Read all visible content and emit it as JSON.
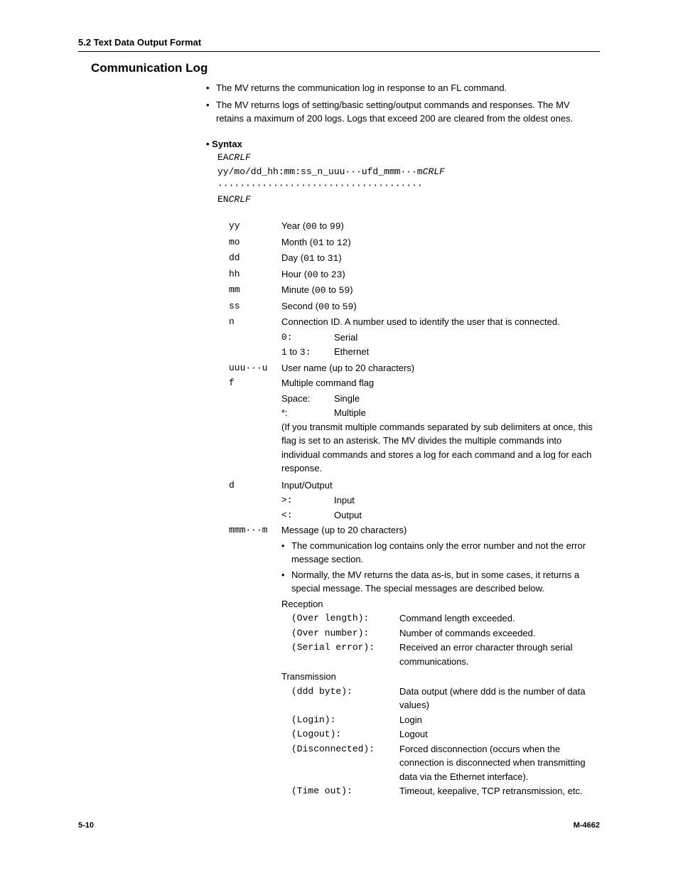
{
  "header": "5.2  Text Data Output Format",
  "title": "Communication Log",
  "intro": [
    "The MV returns the communication log in response to an FL command.",
    "The MV returns logs of setting/basic setting/output commands and responses. The MV retains a maximum of 200 logs. Logs that exceed 200 are cleared from the oldest ones."
  ],
  "syntax_label": "•  Syntax",
  "syntax_lines": {
    "l1a": "EA",
    "l1b": "CRLF",
    "l2a": "yy/mo/dd_hh:mm:ss_n_uuu···ufd_mmm···m",
    "l2b": "CRLF",
    "l3": "·····································",
    "l4a": "EN",
    "l4b": "CRLF"
  },
  "defs": {
    "yy": {
      "k": "yy",
      "pre": "Year (",
      "r": "00",
      "mid": " to ",
      "r2": "99",
      "post": ")"
    },
    "mo": {
      "k": "mo",
      "pre": "Month (",
      "r": "01",
      "mid": " to ",
      "r2": "12",
      "post": ")"
    },
    "dd": {
      "k": "dd",
      "pre": "Day (",
      "r": "01",
      "mid": " to ",
      "r2": "31",
      "post": ")"
    },
    "hh": {
      "k": "hh",
      "pre": "Hour (",
      "r": "00",
      "mid": " to ",
      "r2": "23",
      "post": ")"
    },
    "mm": {
      "k": "mm",
      "pre": "Minute (",
      "r": "00",
      "mid": " to ",
      "r2": "59",
      "post": ")"
    },
    "ss": {
      "k": "ss",
      "pre": "Second (",
      "r": "00",
      "mid": " to ",
      "r2": "59",
      "post": ")"
    }
  },
  "n": {
    "k": "n",
    "desc": "Connection ID. A number used to identify the user that is connected.",
    "r1k": "0:",
    "r1v": "Serial",
    "r2pre": "1",
    "r2mid": " to ",
    "r2suf": "3:",
    "r2v": "Ethernet"
  },
  "uuu": {
    "k": "uuu···u",
    "v": "User name (up to 20 characters)"
  },
  "f": {
    "k": "f",
    "head": "Multiple command flag",
    "r1k": "Space:",
    "r1v": "Single",
    "r2k": "*:",
    "r2v": "Multiple",
    "note": "(If you transmit multiple commands separated by sub delimiters at once, this flag is set to an asterisk. The MV divides the multiple commands into individual commands and stores a log for each command and a log for each response."
  },
  "d": {
    "k": "d",
    "head": "Input/Output",
    "r1k": ">:",
    "r1v": "Input",
    "r2k": "<:",
    "r2v": "Output"
  },
  "mmm": {
    "k": "mmm···m",
    "head": "Message (up to 20 characters)",
    "b1": "The communication log contains only the error number and not the error message section.",
    "b2": "Normally, the MV returns the data as-is, but in some cases, it returns a special message. The special messages are described below.",
    "rx": "Reception",
    "rx1k": "(Over length):",
    "rx1v": "Command length exceeded.",
    "rx2k": "(Over number):",
    "rx2v": "Number of commands exceeded.",
    "rx3k": "(Serial error):",
    "rx3v": "Received an error character through serial communications.",
    "tx": "Transmission",
    "tx1k": "(ddd byte):",
    "tx1v": "Data output (where ddd is the number of data values)",
    "tx2k": "(Login):",
    "tx2v": "Login",
    "tx3k": "(Logout):",
    "tx3v": "Logout",
    "tx4k": "(Disconnected):",
    "tx4v": "Forced disconnection (occurs when the connection is disconnected when transmitting data via the Ethernet interface).",
    "tx5k": "(Time out):",
    "tx5v": "Timeout, keepalive, TCP retransmission, etc."
  },
  "footer": {
    "left": "5-10",
    "right": "M-4662"
  }
}
